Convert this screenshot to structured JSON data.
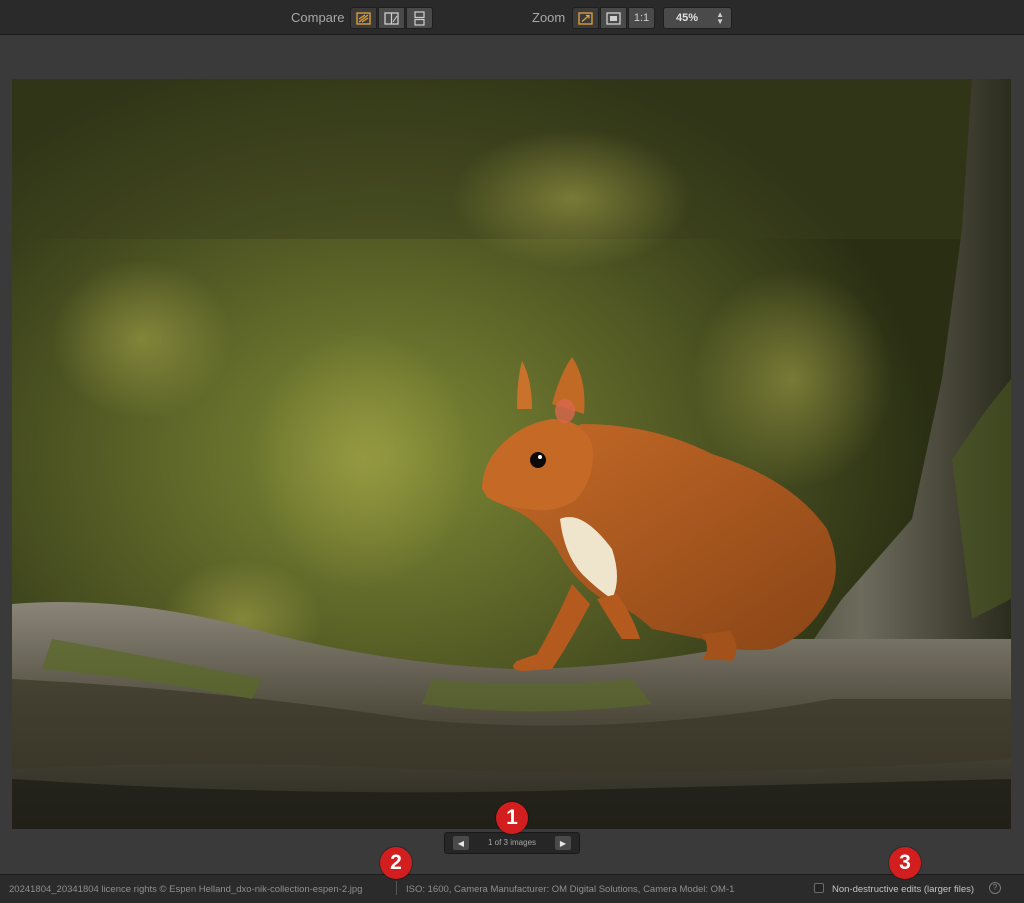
{
  "toolbar": {
    "compare_label": "Compare",
    "zoom_label": "Zoom",
    "compare_buttons": [
      "compare-single-icon",
      "compare-split-icon",
      "compare-stacked-icon"
    ],
    "zoom_buttons": [
      "zoom-fit-icon",
      "zoom-fill-icon",
      "1:1"
    ],
    "zoom_value": "45%",
    "accent_color": "#e8a33c"
  },
  "pager": {
    "text": "1 of 3 images",
    "prev_icon": "triangle-left-icon",
    "next_icon": "triangle-right-icon"
  },
  "statusbar": {
    "filename": "20241804_20341804 licence rights © Espen Helland_dxo-nik-collection-espen-2.jpg",
    "metadata": "ISO: 1600, Camera Manufacturer: OM Digital Solutions, Camera Model: OM-1",
    "non_destructive_label": "Non-destructive edits (larger files)",
    "non_destructive_checked": false,
    "help": "?"
  },
  "markers": [
    "1",
    "2",
    "3"
  ],
  "colors": {
    "marker_red": "#d21e1e",
    "background": "#3a3a3a"
  }
}
